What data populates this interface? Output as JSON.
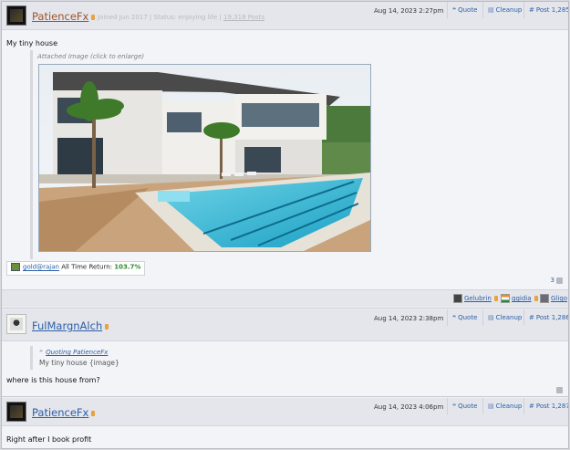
{
  "posts": [
    {
      "username": "PatienceFx",
      "meta_joined": "Joined Jun 2017",
      "meta_status": "Status: enjoying life",
      "meta_posts": "19,318 Posts",
      "date": "Aug 14, 2023 2:27pm",
      "quote_label": "Quote",
      "cleanup_label": "Cleanup",
      "post_number": "Post 1,285",
      "text": "My tiny house",
      "attachment_caption": "Attached Image (click to enlarge)",
      "signature": {
        "link": "gold@rajan",
        "label": "All Time Return:",
        "value": "103.7%"
      },
      "likes": "3",
      "likers": [
        "Gelubrin",
        "ggidia",
        "Gligo"
      ]
    },
    {
      "username": "FulMargnAlch",
      "date": "Aug 14, 2023 2:38pm",
      "quote_label": "Quote",
      "cleanup_label": "Cleanup",
      "post_number": "Post 1,286",
      "quote_header": "Quoting PatienceFx",
      "quote_body": "My tiny house {image}",
      "text": "where is this house from?"
    },
    {
      "username": "PatienceFx",
      "date": "Aug 14, 2023 4:06pm",
      "quote_label": "Quote",
      "cleanup_label": "Cleanup",
      "post_number": "Post 1,287",
      "text": "Right after I book profit"
    }
  ],
  "icons": {
    "quote": "quote-icon",
    "cleanup": "cleanup-icon",
    "post": "hash-icon",
    "like": "thumbs-up-icon"
  },
  "colors": {
    "link": "#2a5ea8",
    "gold_user": "#a0522d",
    "return": "#2e8b2e"
  }
}
